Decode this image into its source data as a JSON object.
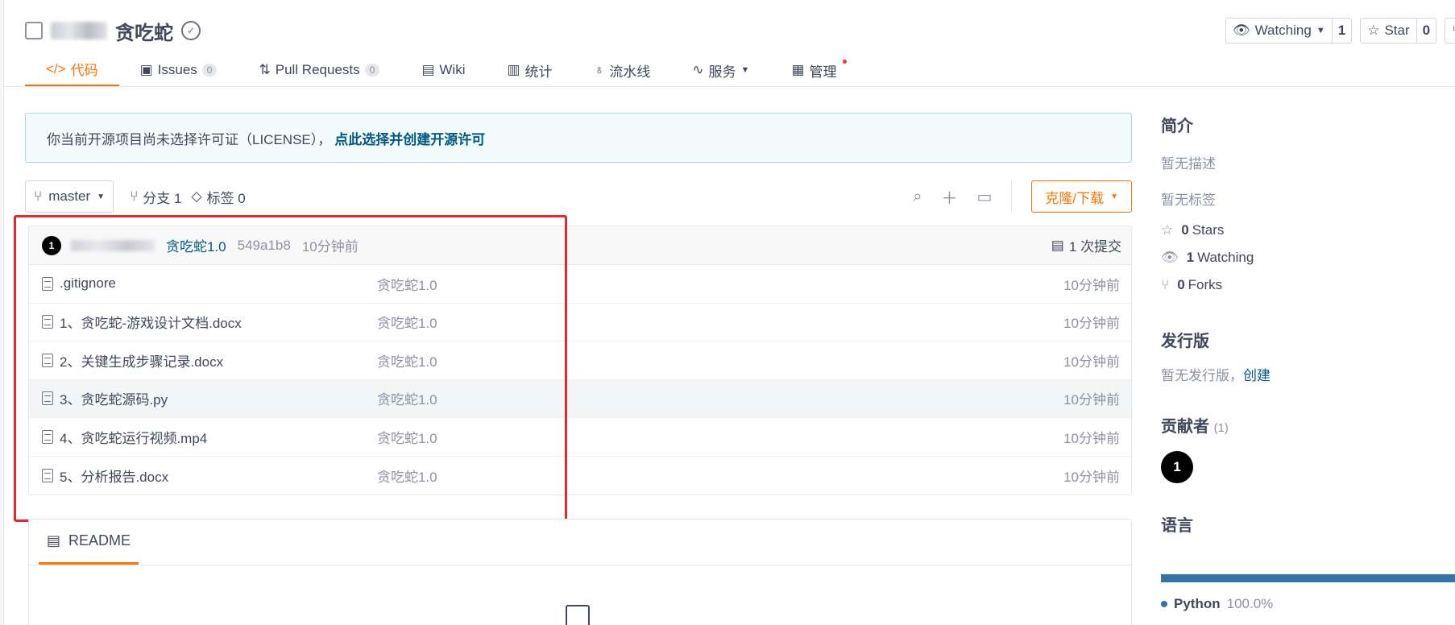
{
  "repo": {
    "name": "贪吃蛇"
  },
  "header_buttons": {
    "watching_label": "Watching",
    "watching_count": "1",
    "star_label": "Star",
    "star_count": "0"
  },
  "tabs": [
    {
      "label": "代码",
      "icon": "code-icon"
    },
    {
      "label": "Issues",
      "count": "0",
      "icon": "issues-icon"
    },
    {
      "label": "Pull Requests",
      "count": "0",
      "icon": "pull-request-icon"
    },
    {
      "label": "Wiki",
      "icon": "wiki-icon"
    },
    {
      "label": "统计",
      "icon": "stats-icon"
    },
    {
      "label": "流水线",
      "icon": "pipeline-icon"
    },
    {
      "label": "服务",
      "icon": "service-icon"
    },
    {
      "label": "管理",
      "icon": "manage-icon"
    }
  ],
  "license_banner": {
    "text": "你当前开源项目尚未选择许可证（LICENSE），",
    "link": "点此选择并创建开源许可"
  },
  "branch_bar": {
    "branch": "master",
    "branches": "分支 1",
    "tags": "标签 0",
    "clone": "克隆/下载"
  },
  "latest_commit": {
    "avatar": "1",
    "message": "贪吃蛇1.0",
    "sha": "549a1b8",
    "time": "10分钟前",
    "commits": "1 次提交"
  },
  "files": [
    {
      "name": ".gitignore",
      "commit": "贪吃蛇1.0",
      "time": "10分钟前"
    },
    {
      "name": "1、贪吃蛇-游戏设计文档.docx",
      "commit": "贪吃蛇1.0",
      "time": "10分钟前"
    },
    {
      "name": "2、关键生成步骤记录.docx",
      "commit": "贪吃蛇1.0",
      "time": "10分钟前"
    },
    {
      "name": "3、贪吃蛇源码.py",
      "commit": "贪吃蛇1.0",
      "time": "10分钟前"
    },
    {
      "name": "4、贪吃蛇运行视频.mp4",
      "commit": "贪吃蛇1.0",
      "time": "10分钟前"
    },
    {
      "name": "5、分析报告.docx",
      "commit": "贪吃蛇1.0",
      "time": "10分钟前"
    }
  ],
  "readme": {
    "label": "README"
  },
  "sidebar": {
    "intro_title": "简介",
    "no_desc": "暂无描述",
    "no_tags": "暂无标签",
    "stars": {
      "count": "0",
      "label": "Stars"
    },
    "watching": {
      "count": "1",
      "label": "Watching"
    },
    "forks": {
      "count": "0",
      "label": "Forks"
    },
    "release_title": "发行版",
    "no_release": "暂无发行版，",
    "create": "创建",
    "contributors_title": "贡献者",
    "contributors_count": "(1)",
    "contributor_avatar": "1",
    "language_title": "语言",
    "language_name": "Python",
    "language_percent": "100.0%"
  },
  "colors": {
    "accent": "#fe7300",
    "link": "#005980",
    "python": "#3572a5",
    "highlight": "#e8272b"
  }
}
